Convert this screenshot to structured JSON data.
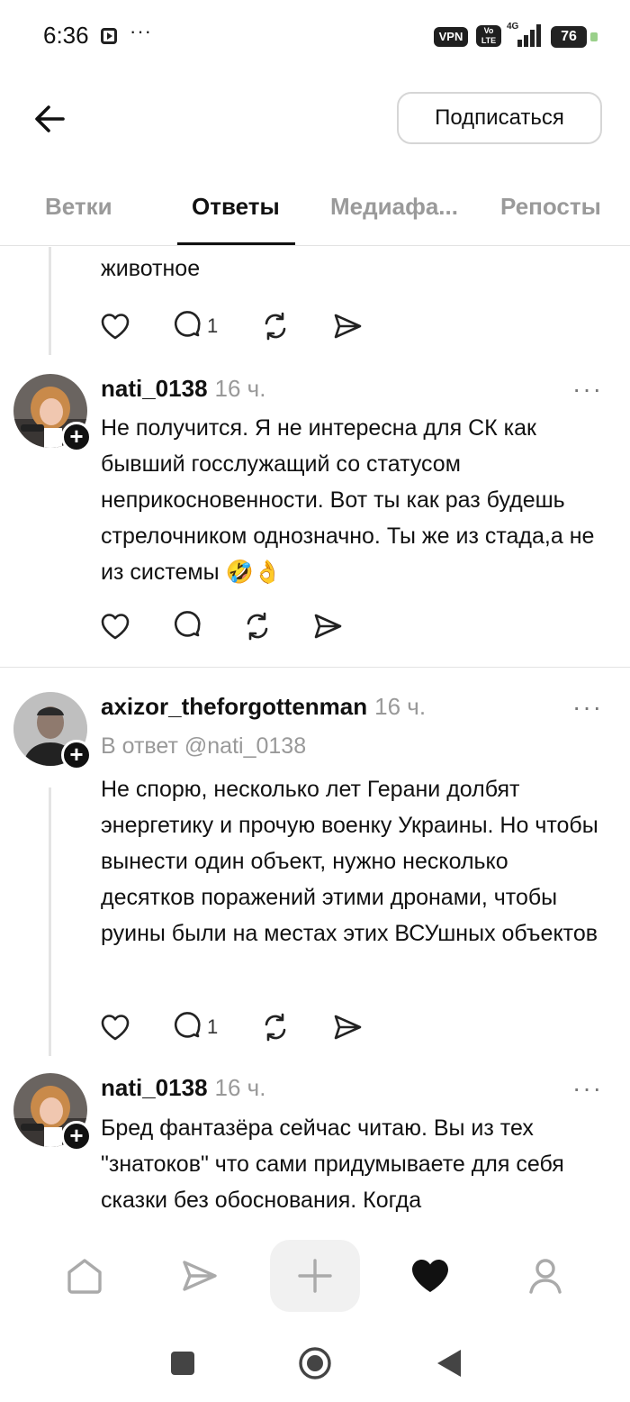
{
  "status_bar": {
    "time": "6:36",
    "dots": "···",
    "vpn": "VPN",
    "volte_top": "Vo",
    "volte_bottom": "LTE",
    "network": "4G",
    "battery": "76"
  },
  "header": {
    "follow_label": "Подписаться"
  },
  "tabs": [
    {
      "label": "Ветки",
      "active": false
    },
    {
      "label": "Ответы",
      "active": true
    },
    {
      "label": "Медиафа...",
      "active": false
    },
    {
      "label": "Репосты",
      "active": false
    }
  ],
  "posts": [
    {
      "text": "животное",
      "reply_count": "1"
    },
    {
      "username": "nati_0138",
      "time_ago": "16 ч.",
      "text": "Не получится. Я не интересна для СК как бывший госслужащий со статусом неприкосновенности. Вот ты как раз будешь стрелочником однозначно. Ты же из стада,а не из системы 🤣👌",
      "more": "···"
    },
    {
      "username": "axizor_theforgottenman",
      "time_ago": "16 ч.",
      "reply_to": "В ответ @nati_0138",
      "text": "Не спорю, несколько лет Герани долбят энергетику и прочую военку Украины. Но чтобы вынести один объект, нужно несколько десятков поражений этими дронами, чтобы руины были на местах этих ВСУшных объектов",
      "reply_count": "1",
      "more": "···"
    },
    {
      "username": "nati_0138",
      "time_ago": "16 ч.",
      "text": "Бред фантазёра сейчас читаю. Вы из тех \"знатоков\" что сами придумываете для себя сказки без обоснования. Когда",
      "more": "···"
    }
  ],
  "bottom_nav": [
    "home-icon",
    "send-icon",
    "create-icon",
    "activity-heart-icon",
    "profile-icon"
  ],
  "colors": {
    "text": "#111111",
    "muted": "#999999",
    "divider": "#e3e3e3"
  }
}
